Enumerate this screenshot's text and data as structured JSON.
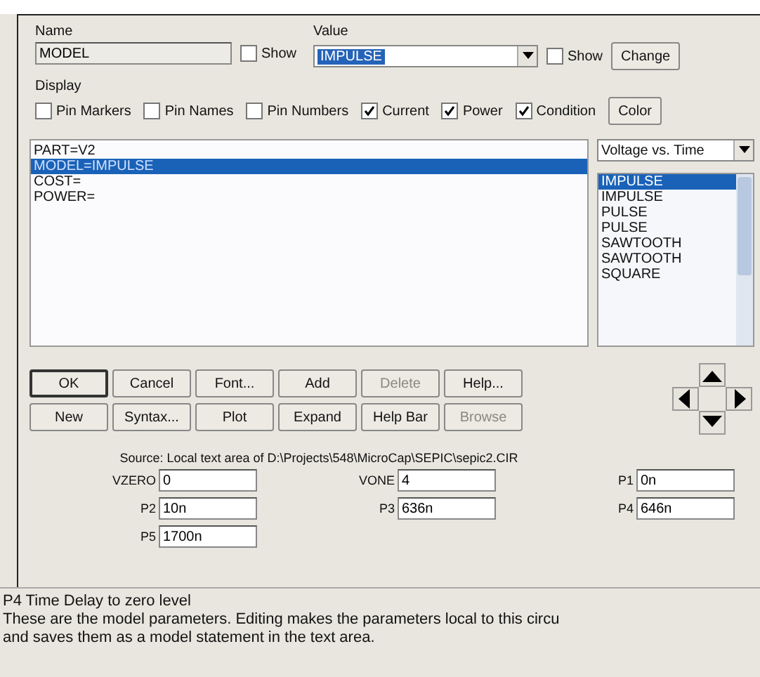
{
  "name": {
    "label": "Name",
    "value": "MODEL",
    "show": {
      "label": "Show",
      "checked": false
    }
  },
  "value": {
    "label": "Value",
    "value": "IMPULSE",
    "show": {
      "label": "Show",
      "checked": false
    },
    "button": "Change"
  },
  "display": {
    "label": "Display",
    "options": [
      {
        "label": "Pin Markers",
        "checked": false
      },
      {
        "label": "Pin Names",
        "checked": false
      },
      {
        "label": "Pin Numbers",
        "checked": false
      },
      {
        "label": "Current",
        "checked": true
      },
      {
        "label": "Power",
        "checked": true
      },
      {
        "label": "Condition",
        "checked": true
      }
    ],
    "button": "Color"
  },
  "text_lines": [
    {
      "text": "PART=V2",
      "selected": false
    },
    {
      "text": "MODEL=IMPULSE",
      "selected": true
    },
    {
      "text": "COST=",
      "selected": false
    },
    {
      "text": "POWER=",
      "selected": false
    }
  ],
  "plot_select": "Voltage vs. Time",
  "models": [
    {
      "text": "IMPULSE",
      "selected": true
    },
    {
      "text": "IMPULSE",
      "selected": false
    },
    {
      "text": "PULSE",
      "selected": false
    },
    {
      "text": "PULSE",
      "selected": false
    },
    {
      "text": "SAWTOOTH",
      "selected": false
    },
    {
      "text": "SAWTOOTH",
      "selected": false
    },
    {
      "text": "SQUARE",
      "selected": false
    }
  ],
  "buttons": [
    [
      {
        "label": "OK",
        "disabled": false,
        "default": true
      },
      {
        "label": "Cancel",
        "disabled": false,
        "default": false
      },
      {
        "label": "Font...",
        "disabled": false,
        "default": false
      },
      {
        "label": "Add",
        "disabled": false,
        "default": false
      },
      {
        "label": "Delete",
        "disabled": true,
        "default": false
      },
      {
        "label": "Help...",
        "disabled": false,
        "default": false
      }
    ],
    [
      {
        "label": "New",
        "disabled": false,
        "default": false
      },
      {
        "label": "Syntax...",
        "disabled": false,
        "default": false
      },
      {
        "label": "Plot",
        "disabled": false,
        "default": false
      },
      {
        "label": "Expand",
        "disabled": false,
        "default": false
      },
      {
        "label": "Help Bar",
        "disabled": false,
        "default": false
      },
      {
        "label": "Browse",
        "disabled": true,
        "default": false
      }
    ]
  ],
  "source": "Source: Local text area of D:\\Projects\\548\\MicroCap\\SEPIC\\sepic2.CIR",
  "parameters": [
    {
      "name": "VZERO",
      "value": "0"
    },
    {
      "name": "VONE",
      "value": "4"
    },
    {
      "name": "P1",
      "value": "0n"
    },
    {
      "name": "P2",
      "value": "10n"
    },
    {
      "name": "P3",
      "value": "636n"
    },
    {
      "name": "P4",
      "value": "646n"
    },
    {
      "name": "P5",
      "value": "1700n"
    }
  ],
  "help_bar": [
    "P4 Time Delay to zero level",
    "These are the model parameters. Editing makes the parameters local to this circu",
    "and saves them as a model statement in the text area."
  ]
}
